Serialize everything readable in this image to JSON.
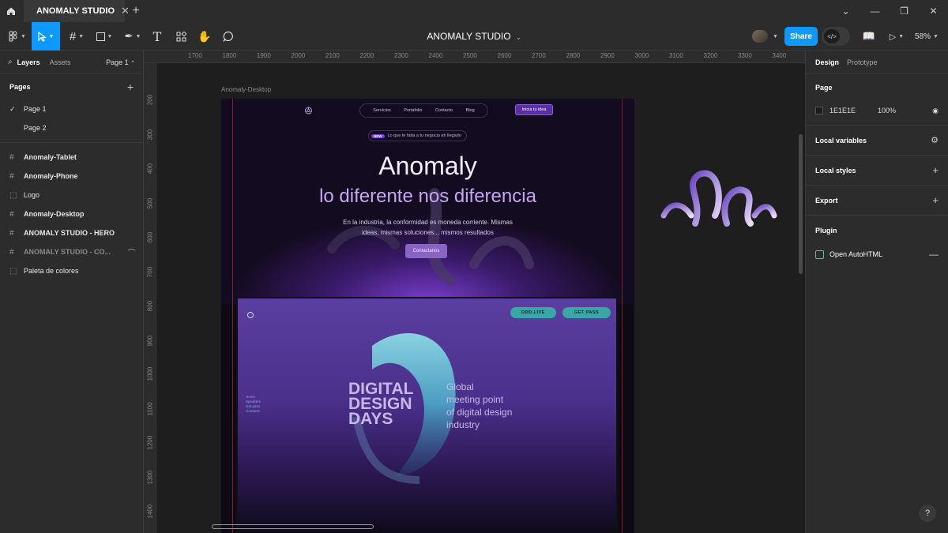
{
  "tab": {
    "title": "ANOMALY STUDIO"
  },
  "toolbar": {
    "file_title": "ANOMALY STUDIO",
    "share_label": "Share",
    "zoom": "58%"
  },
  "left_panel": {
    "tab_layers": "Layers",
    "tab_assets": "Assets",
    "page_selector": "Page 1",
    "pages_heading": "Pages",
    "pages": [
      {
        "label": "Page 1",
        "selected": true
      },
      {
        "label": "Page 2",
        "selected": false
      }
    ],
    "layers": [
      {
        "label": "Anomaly-Tablet",
        "icon": "frame-icon"
      },
      {
        "label": "Anomaly-Phone",
        "icon": "frame-icon"
      },
      {
        "label": "Logo",
        "icon": "section-icon"
      },
      {
        "label": "Anomaly-Desktop",
        "icon": "frame-icon"
      },
      {
        "label": "ANOMALY STUDIO - HERO",
        "icon": "frame-icon"
      },
      {
        "label": "ANOMALY STUDIO - CO...",
        "icon": "frame-icon"
      },
      {
        "label": "Paleta de colores",
        "icon": "section-icon"
      }
    ]
  },
  "rulers": {
    "top": [
      "1700",
      "1800",
      "1900",
      "2000",
      "2100",
      "2200",
      "2300",
      "2400",
      "2500",
      "2600",
      "2700",
      "2800",
      "2900",
      "3000",
      "3100",
      "3200",
      "3300",
      "3400"
    ],
    "left": [
      "200",
      "300",
      "400",
      "500",
      "600",
      "700",
      "800",
      "900",
      "1000",
      "1100",
      "1200",
      "1300",
      "1400"
    ]
  },
  "canvas": {
    "frame_label": "Anomaly-Desktop",
    "site": {
      "nav": [
        "Servicios",
        "Portafolio",
        "Contacto",
        "Blog"
      ],
      "nav_cta": "Inicia tu idea",
      "badge_new": "NEW",
      "badge_text": "Lo que te falta a tu negocio ah llegado",
      "title": "Anomaly",
      "subtitle": "lo diferente nos diferencia",
      "paragraph_line1": "En la industria, la conformidad es moneda corriente. Mismas",
      "paragraph_line2": "ideas, mismas soluciones... mismos resultados",
      "button": "Contactanos"
    },
    "showcase": {
      "pill_left": "DDD.LIVE",
      "pill_right": "GET PASS",
      "headline": [
        "DIGITAL",
        "DESIGN",
        "DAYS"
      ],
      "side_text": [
        "Global",
        "meeting point",
        "of digital design",
        "industry"
      ],
      "menu": [
        "Home",
        "Speakers",
        "Get pass",
        "Contacts"
      ]
    }
  },
  "right_panel": {
    "tab_design": "Design",
    "tab_prototype": "Prototype",
    "page_heading": "Page",
    "page_color": "1E1E1E",
    "page_opacity": "100%",
    "local_variables": "Local variables",
    "local_styles": "Local styles",
    "export": "Export",
    "plugin_heading": "Plugin",
    "plugin_name": "Open AutoHTML"
  },
  "colors": {
    "accent": "#0d99ff",
    "canvas": "#1e1e1e",
    "panel": "#2c2c2c",
    "brand_purple": "#7b3fd0"
  }
}
